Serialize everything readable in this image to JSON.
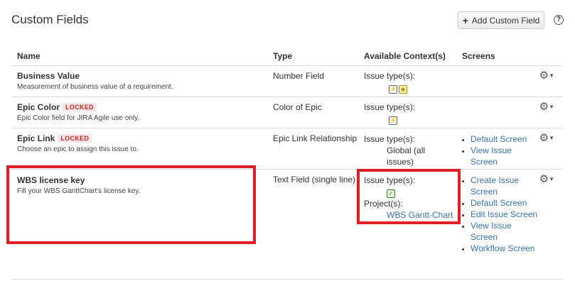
{
  "header": {
    "title": "Custom Fields",
    "add_button_label": "Add Custom Field",
    "help_label": "?"
  },
  "columns": {
    "name": "Name",
    "type": "Type",
    "context": "Available Context(s)",
    "screens": "Screens"
  },
  "rows": [
    {
      "name": "Business Value",
      "locked": "",
      "description": "Measurement of business value of a requirement.",
      "type": "Number Field",
      "context_label": "Issue type(s):",
      "issue_type_icons": [
        "story-icon",
        "idea-icon"
      ],
      "screens": []
    },
    {
      "name": "Epic Color",
      "locked": "LOCKED",
      "description": "Epic Color field for JIRA Agile use only.",
      "type": "Color of Epic",
      "context_label": "Issue type(s):",
      "issue_type_icons": [
        "story-icon"
      ],
      "screens": []
    },
    {
      "name": "Epic Link",
      "locked": "LOCKED",
      "description": "Choose an epic to assign this issue to.",
      "type": "Epic Link Relationship",
      "context_label": "Issue type(s):",
      "context_value": "Global (all issues)",
      "screens": [
        "Default Screen",
        "View Issue Screen"
      ]
    },
    {
      "name": "WBS license key",
      "locked": "",
      "description": "Fill your WBS GanttChart's license key.",
      "type": "Text Field (single line)",
      "context_label": "Issue type(s):",
      "issue_type_icons": [
        "check-icon"
      ],
      "project_label": "Project(s):",
      "project_value": "WBS Gantt-Chart",
      "screens": [
        "Create Issue Screen",
        "Default Screen",
        "Edit Issue Screen",
        "View Issue Screen",
        "Workflow Screen"
      ]
    }
  ],
  "colors": {
    "highlight": "#e01e26",
    "link": "#3b73af",
    "locked_bg": "#fde6e6",
    "locked_text": "#c32a2a"
  }
}
